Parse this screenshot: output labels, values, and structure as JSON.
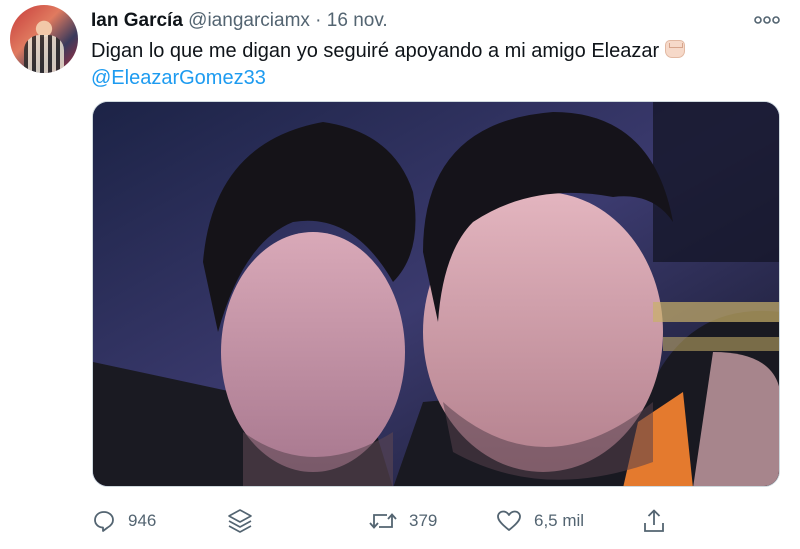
{
  "tweet": {
    "display_name": "Ian García",
    "handle": "@iangarciamx",
    "separator": "·",
    "date": "16 nov.",
    "text": "Digan lo que me digan yo seguiré apoyando a mi amigo Eleazar",
    "mention": "@EleazarGomez33",
    "emoji": "oncoming-fist-light-skin"
  },
  "actions": {
    "reply_count": "946",
    "retweet_count": "379",
    "like_count": "6,5 mil"
  },
  "colors": {
    "link": "#1d9bf0",
    "secondary_text": "#536471",
    "primary_text": "#0f1419"
  }
}
